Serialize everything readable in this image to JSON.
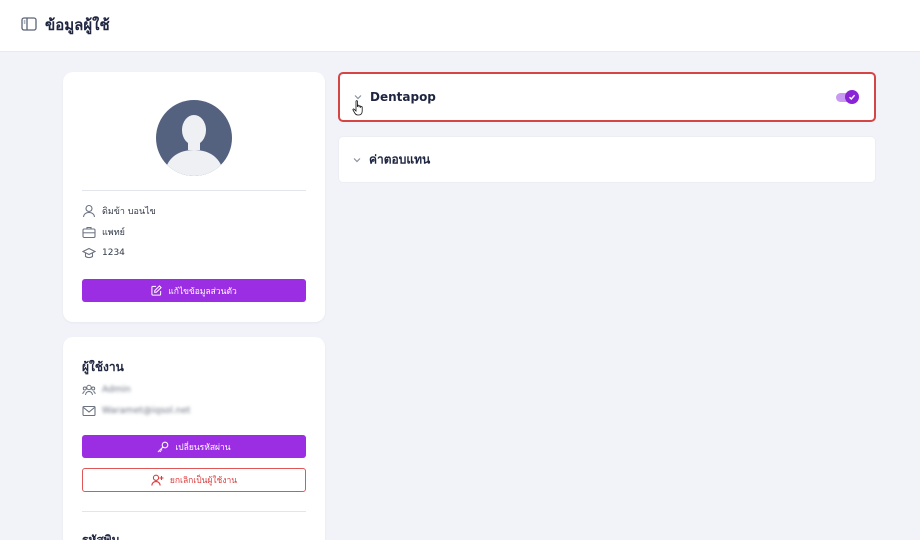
{
  "header": {
    "title": "ข้อมูลผู้ใช้",
    "icon": "sidebar-panel-icon"
  },
  "profile": {
    "avatar_icon": "user-avatar-icon",
    "name": "ดิมข้า บอนไข",
    "role": "แพทย์",
    "license": "1234",
    "edit_button": "แก้ไขข้อมูลส่วนตัว"
  },
  "account": {
    "title": "ผู้ใช้งาน",
    "user_type": "Admin",
    "email": "Waramet@iqsol.net",
    "change_password_button": "เปลี่ยนรหัสผ่าน",
    "cancel_user_button": "ยกเลิกเป็นผู้ใช้งาน",
    "next_section_title": "รหัสพิน"
  },
  "accordion": [
    {
      "label": "Dentapop",
      "toggle_on": true
    },
    {
      "label": "ค่าตอบแทน"
    }
  ],
  "colors": {
    "accent": "#9b2de3",
    "danger": "#d64545",
    "background": "#f1f3f8"
  }
}
